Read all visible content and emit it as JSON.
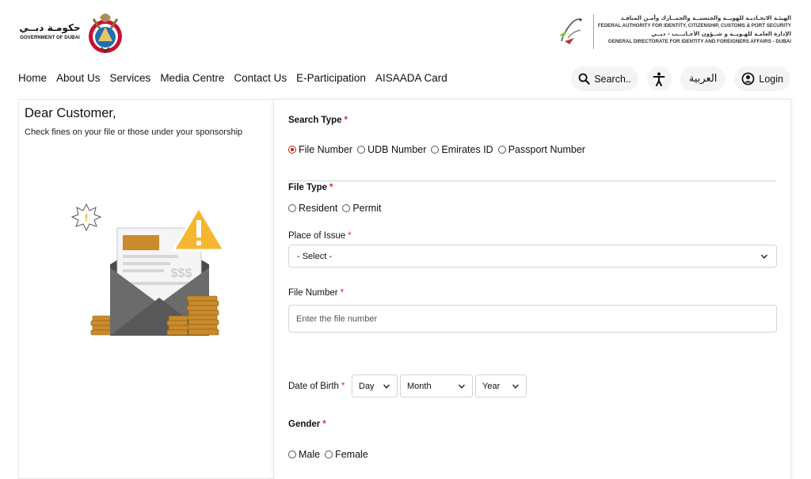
{
  "header": {
    "gov_logo_ar": "حكومـة دبــي",
    "gov_logo_en": "GOVERNMENT OF DUBAI",
    "authority_lines": [
      "الهيئـة الاتحـاديـة للهويــة والجنسيــة والجمــارك وأمـن المنافـذ",
      "FEDERAL AUTHORITY FOR IDENTITY, CITIZENSHIP, CUSTOMS & PORT SECURITY",
      "الإدارة العامـة للهـويــة و شــؤون الأجـانـــب - دبــي",
      "GENERAL DIRECTORATE FOR IDENTITY AND FOREIGNERS AFFAIRS - DUBAI"
    ]
  },
  "nav": {
    "links": [
      "Home",
      "About Us",
      "Services",
      "Media Centre",
      "Contact Us",
      "E-Participation",
      "AISAADA Card"
    ],
    "search_label": "Search..",
    "arabic_label": "العربية",
    "login_label": "Login"
  },
  "intro": {
    "greeting": "Dear Customer,",
    "subtitle": "Check fines on your file or those under your sponsorship",
    "illustration_text": "$$$"
  },
  "form": {
    "search_type": {
      "label": "Search Type",
      "options": [
        "File Number",
        "UDB Number",
        "Emirates ID",
        "Passport Number"
      ],
      "selected": "File Number"
    },
    "file_type": {
      "label": "File Type",
      "options": [
        "Resident",
        "Permit"
      ]
    },
    "place_of_issue": {
      "label": "Place of Issue",
      "value": "- Select -"
    },
    "file_number": {
      "label": "File Number",
      "placeholder": "Enter the file number"
    },
    "dob": {
      "label": "Date of Birth",
      "day": "Day",
      "month": "Month",
      "year": "Year"
    },
    "gender": {
      "label": "Gender",
      "options": [
        "Male",
        "Female"
      ]
    },
    "required_mark": "*"
  },
  "colors": {
    "accent_red": "#b42318",
    "required_red": "#d92d20",
    "border": "#d1d5db"
  }
}
